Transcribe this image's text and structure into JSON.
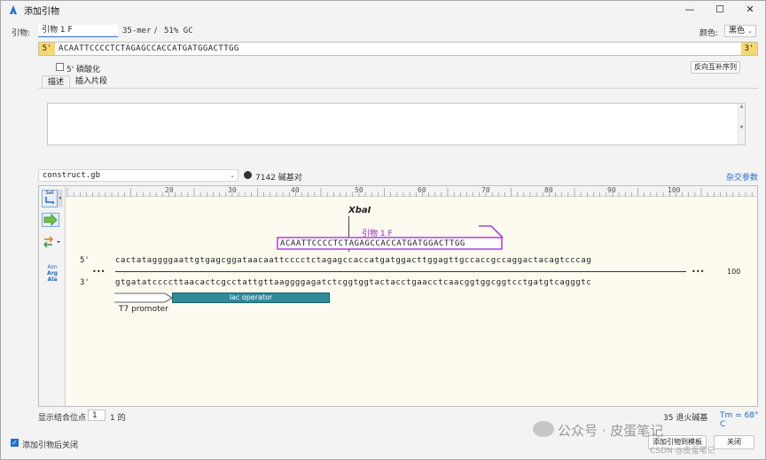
{
  "window": {
    "title": "添加引物",
    "controls": [
      "—",
      "☐",
      "✕"
    ]
  },
  "primer": {
    "label": "引物:",
    "name": "引物 1 F",
    "length": "35-mer",
    "separator": "/",
    "gc": "51% GC",
    "color_label": "颜色:",
    "color_value": "黑色",
    "end5": "5'",
    "end3": "3'",
    "sequence": "ACAATTCCCCTCTAGAGCCACCATGATGGACTTGG",
    "phospho_label": "5' 磷酸化",
    "revcomp_button": "反向互补序列"
  },
  "tabs": [
    "描述",
    "插入片段"
  ],
  "file": {
    "name": "construct.gb",
    "bp": "7142 碱基对",
    "params_link": "杂交参数"
  },
  "ruler": {
    "ticks": [
      "20",
      "30",
      "40",
      "50",
      "60",
      "70",
      "80",
      "90",
      "100"
    ]
  },
  "map": {
    "site": "XbaI",
    "primer_label": "引物 1 F",
    "primer_seq": "ACAATTCCCCTCTAGAGCCACCATGATGGACTTGG",
    "top_prefix": "5'",
    "bottom_prefix": "3'",
    "top_strand": "cactataggggaattgtgagcggataacaattcccctctagagccaccatgatggacttggagttgccaccgccaggactacagtcccag",
    "bottom_strand": "gtgatatccccttaacactcgcctattgttaaggggagatctcggtggtactacctgaacctcaacggtggcggtcctgatgtcagggtc",
    "dots_left": "•••",
    "dots_right": "•••",
    "pos_right": "100",
    "feature_t7": "T7 promoter",
    "feature_lac": "lac operator",
    "colors": {
      "primer": "#9a1fd4",
      "lac": "#2f8a9a"
    }
  },
  "bottom": {
    "bind_label": "显示结合位点",
    "bind_value": "1",
    "bind_of": "1 的",
    "anneal": "35 退火碱基",
    "tm": "Tm = 68° C",
    "close_label": "添加引物后关闭",
    "add_button": "添加引物到模板",
    "cancel_button": "关闭"
  },
  "watermark": {
    "text": "公众号 · 皮蛋笔记",
    "csdn": "CSDN @皮蛋笔记"
  },
  "icons": {
    "app": "snapgene-icon",
    "sali": "SalI",
    "aa": [
      "Asn",
      "Arg",
      "Ala"
    ]
  }
}
